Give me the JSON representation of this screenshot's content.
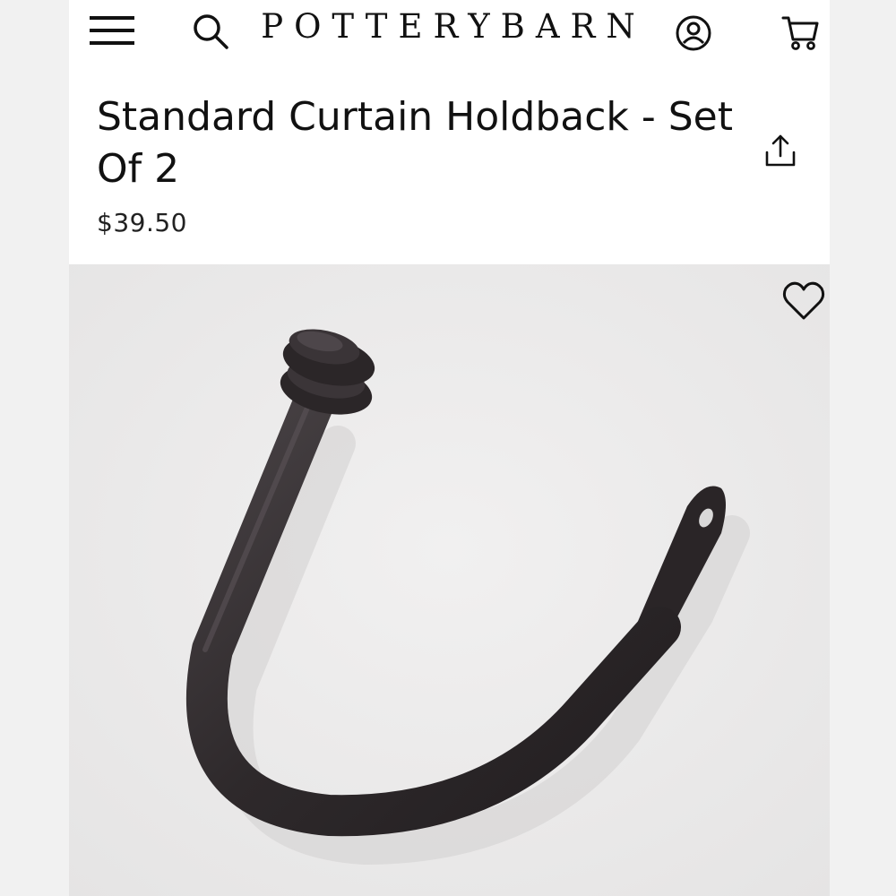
{
  "header": {
    "logo_text": "POTTERYBARN",
    "icons": [
      "menu-icon",
      "search-icon",
      "account-icon",
      "cart-icon"
    ]
  },
  "product": {
    "title": "Standard Curtain Holdback - Set Of 2",
    "price": "$39.50",
    "share_icon": "share-icon",
    "favorite_icon": "heart-icon",
    "image_alt": "holdback-product-image"
  },
  "colors": {
    "text": "#111111",
    "image_bg": "#ecebeb",
    "page_bg": "#f1f1f1",
    "hook": "#2f2a2c"
  }
}
